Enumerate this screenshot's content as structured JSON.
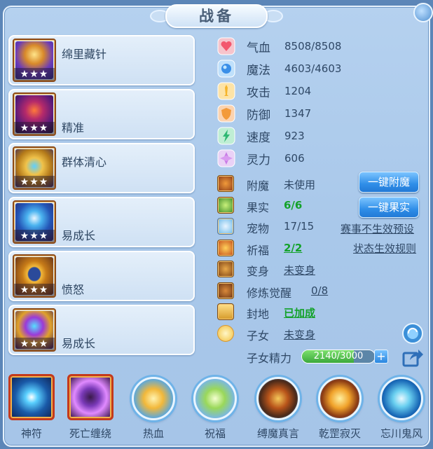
{
  "title": "战备",
  "skills": [
    {
      "name": "绵里藏针",
      "stars": "★★★",
      "icon": "golden-needle-icon"
    },
    {
      "name": "精准",
      "stars": "★★★",
      "icon": "purple-demon-icon"
    },
    {
      "name": "群体清心",
      "stars": "★★★",
      "icon": "golden-crown-icon"
    },
    {
      "name": "易成长",
      "stars": "★★★",
      "icon": "blue-ring-icon"
    },
    {
      "name": "愤怒",
      "stars": "★★★",
      "icon": "gold-bracelet-icon"
    },
    {
      "name": "易成长",
      "stars": "★★★",
      "icon": "purple-gold-totem-icon"
    }
  ],
  "stats": [
    {
      "label": "气血",
      "value": "8508/8508",
      "icon": "heart-icon",
      "color": "#f3576e"
    },
    {
      "label": "魔法",
      "value": "4603/4603",
      "icon": "magic-orb-icon",
      "color": "#3a8fe8"
    },
    {
      "label": "攻击",
      "value": "1204",
      "icon": "sword-icon",
      "color": "#f5b42a"
    },
    {
      "label": "防御",
      "value": "1347",
      "icon": "shield-icon",
      "color": "#f39a3a"
    },
    {
      "label": "速度",
      "value": "923",
      "icon": "lightning-icon",
      "color": "#2fb873"
    },
    {
      "label": "灵力",
      "value": "606",
      "icon": "spirit-icon",
      "color": "#c97be6"
    }
  ],
  "misc": [
    {
      "label": "附魔",
      "value": "未使用",
      "icon": "enchant-icon"
    },
    {
      "label": "果实",
      "value": "6/6",
      "icon": "fruit-icon"
    },
    {
      "label": "宠物",
      "value": "17/15",
      "icon": "pet-icon"
    },
    {
      "label": "祈福",
      "value": "2/2",
      "icon": "bless-icon"
    },
    {
      "label": "变身",
      "value": "未变身",
      "icon": "transform-icon"
    },
    {
      "label": "修炼觉醒",
      "value": "0/8",
      "icon": "cultivation-icon"
    },
    {
      "label": "封地",
      "value": "已加成",
      "icon": "fief-icon"
    },
    {
      "label": "子女",
      "value": "未变身",
      "icon": "children-icon"
    }
  ],
  "buttons": {
    "enchant": "一键附魔",
    "fruit": "一键果实",
    "event_link": "赛事不生效预设",
    "status_link": "状态生效规则"
  },
  "essence": {
    "label": "子女精力",
    "value": "2140/3000",
    "fraction": 0.713
  },
  "bottom": [
    {
      "label": "神符",
      "icon": "rune-icon",
      "style": "square"
    },
    {
      "label": "死亡缠绕",
      "icon": "death-coil-icon",
      "style": "square"
    },
    {
      "label": "热血",
      "icon": "hot-blood-icon",
      "style": "circle"
    },
    {
      "label": "祝福",
      "icon": "blessing-icon",
      "style": "circle"
    },
    {
      "label": "缚魔真言",
      "icon": "bind-demon-icon",
      "style": "circle"
    },
    {
      "label": "乾罡寂灭",
      "icon": "qiangang-icon",
      "style": "circle"
    },
    {
      "label": "忘川鬼风",
      "icon": "ghost-wind-icon",
      "style": "circle"
    }
  ]
}
